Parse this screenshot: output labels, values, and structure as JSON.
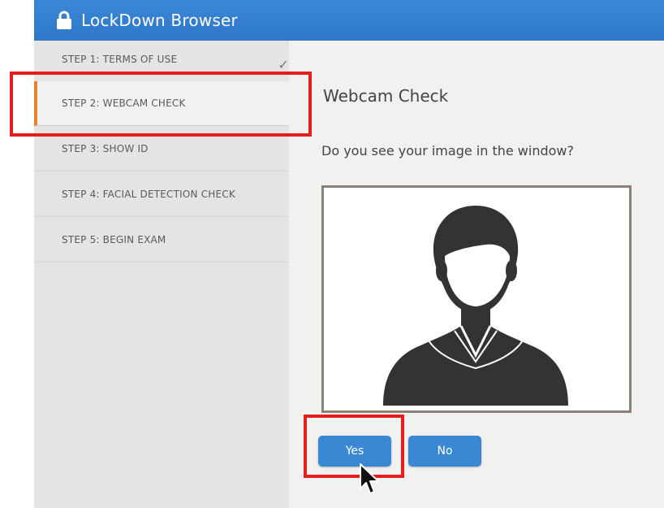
{
  "app": {
    "title": "LockDown Browser"
  },
  "steps": [
    {
      "label": "STEP 1: TERMS OF USE",
      "completed": true
    },
    {
      "label": "STEP 2: WEBCAM CHECK",
      "active": true
    },
    {
      "label": "STEP 3: SHOW ID"
    },
    {
      "label": "STEP 4: FACIAL DETECTION CHECK"
    },
    {
      "label": "STEP 5: BEGIN EXAM"
    }
  ],
  "main": {
    "heading": "Webcam Check",
    "question": "Do you see your image in the window?",
    "yes_label": "Yes",
    "no_label": "No"
  },
  "icons": {
    "title": "lock-icon",
    "step_done": "checkmark-icon",
    "preview": "person-silhouette-icon",
    "pointer": "mouse-cursor-icon"
  },
  "colors": {
    "titlebar": "#2f78c8",
    "active_step_accent": "#e9822e",
    "button": "#3a88d4",
    "annotation": "#e81c1c"
  }
}
